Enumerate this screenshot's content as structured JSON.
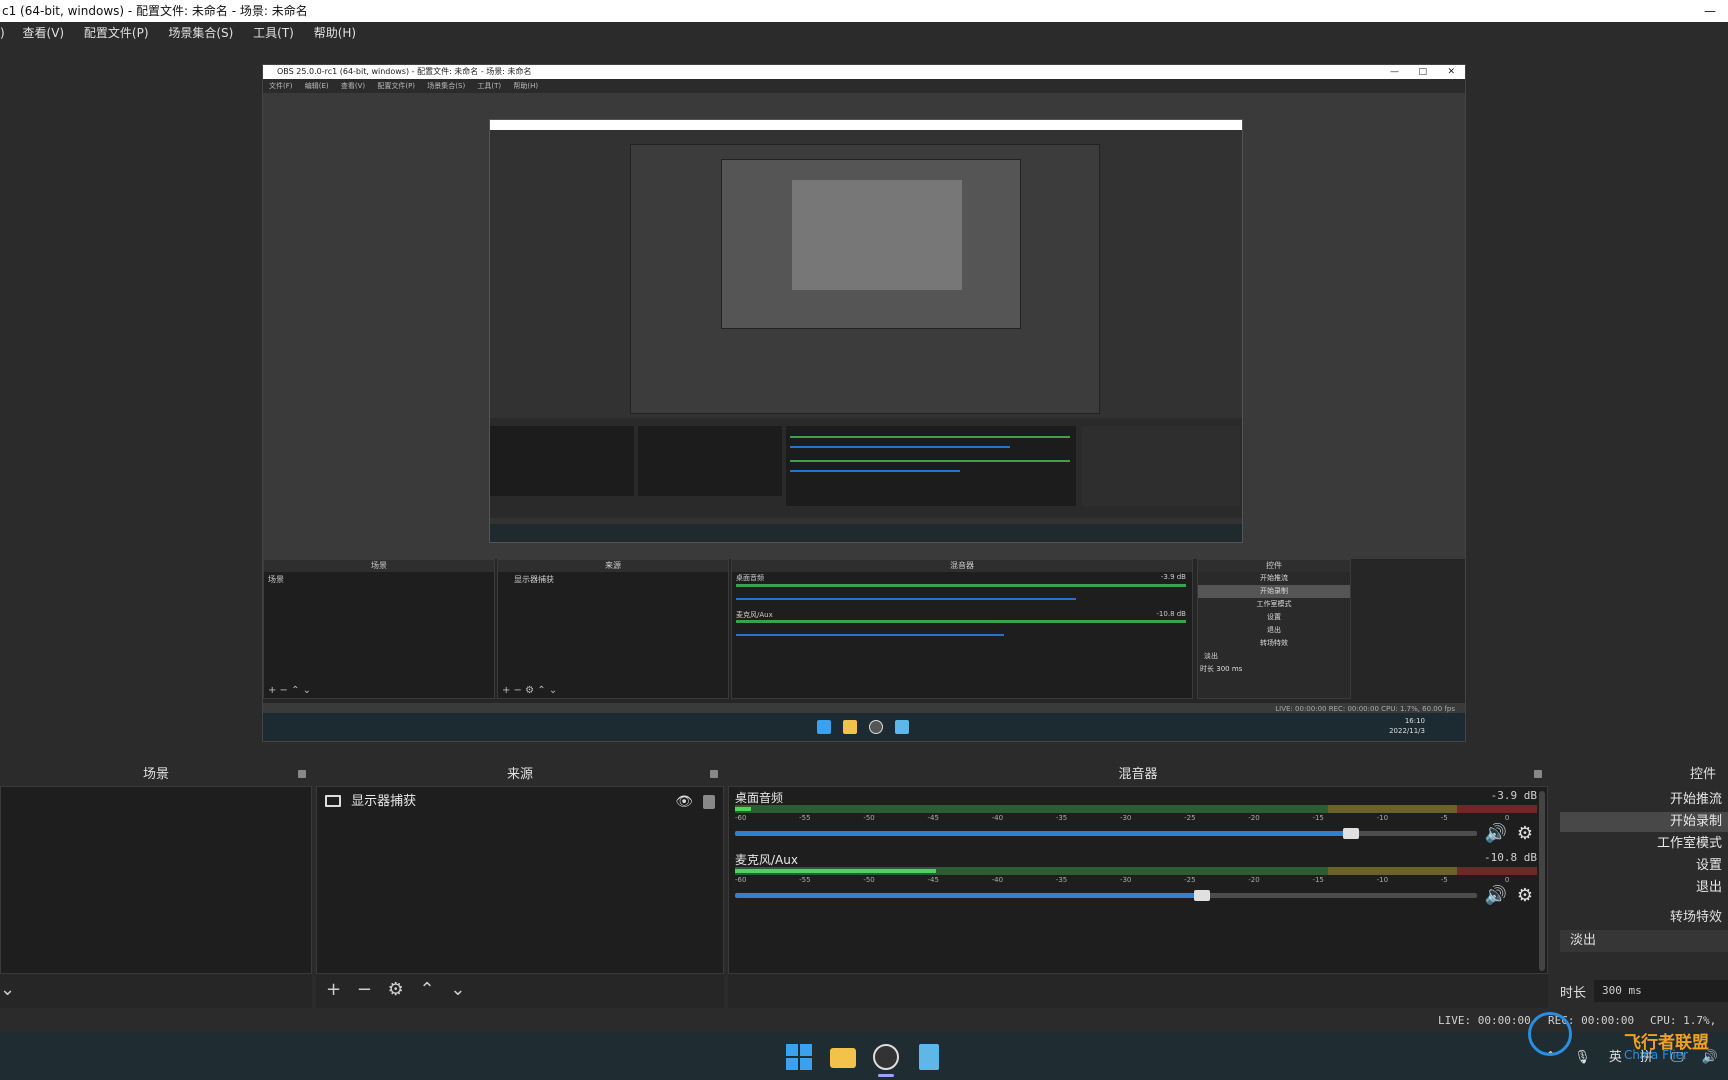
{
  "window": {
    "title": "c1 (64-bit, windows) - 配置文件: 未命名 - 场景: 未命名"
  },
  "menu": [
    "查看(V)",
    "配置文件(P)",
    "场景集合(S)",
    "工具(T)",
    "帮助(H)"
  ],
  "nested": {
    "title": "OBS 25.0.0-rc1 (64-bit, windows) - 配置文件: 未命名 - 场景: 未命名",
    "menu": [
      "文件(F)",
      "编辑(E)",
      "查看(V)",
      "配置文件(P)",
      "场景集合(S)",
      "工具(T)",
      "帮助(H)"
    ],
    "scenes_header": "场景",
    "sources_header": "来源",
    "mixer_header": "混音器",
    "controls_header": "控件",
    "scene_item": "场景",
    "source_item": "显示器捕获",
    "desktop_audio": "桌面音频",
    "mic": "麦克风/Aux",
    "db1": "-3.9 dB",
    "db2": "-10.8 dB",
    "controls": [
      "开始推流",
      "开始录制",
      "工作室模式",
      "设置",
      "退出"
    ],
    "transition": "转场特效",
    "fade": "淡出",
    "duration_label": "时长",
    "duration": "300 ms",
    "status": "LIVE: 00:00:00   REC: 00:00:00   CPU: 1.7%, 60.00 fps",
    "clock_time": "16:10",
    "clock_date": "2022/11/3"
  },
  "docks": {
    "scenes": {
      "title": "场景",
      "tools": [
        "⌄"
      ]
    },
    "sources": {
      "title": "来源",
      "item": "显示器捕获",
      "tools": [
        "+",
        "−",
        "⚙",
        "⌃",
        "⌄"
      ]
    },
    "mixer": {
      "title": "混音器",
      "ticks": [
        "-60",
        "-55",
        "-50",
        "-45",
        "-40",
        "-35",
        "-30",
        "-25",
        "-20",
        "-15",
        "-10",
        "-5",
        "0"
      ],
      "channels": [
        {
          "name": "桌面音频",
          "db": "-3.9 dB",
          "level": 0.02,
          "volume": 0.83
        },
        {
          "name": "麦克风/Aux",
          "db": "-10.8 dB",
          "level": 0.25,
          "volume": 0.63
        }
      ]
    },
    "controls": {
      "title": "控件",
      "buttons": [
        "开始推流",
        "开始录制",
        "工作室模式",
        "设置",
        "退出"
      ],
      "active": "开始录制",
      "transition_label": "转场特效",
      "transition_value": "淡出",
      "duration_label": "时长",
      "duration_value": "300 ms"
    }
  },
  "status": {
    "live": "LIVE: 00:00:00",
    "rec": "REC: 00:00:00",
    "cpu": "CPU: 1.7%, 60"
  },
  "tray": {
    "items": [
      "^",
      "🎙",
      "英",
      "拼",
      "🖵",
      "🔊"
    ]
  },
  "watermark": {
    "cn": "飞行者联盟",
    "en": "China Flier"
  },
  "colors": {
    "bg": "#2b2b2b",
    "dock": "#1e1e1e",
    "meter_green": "#4fd35a",
    "slider_blue": "#2f7fd3",
    "taskbar": "#1f2d32"
  }
}
